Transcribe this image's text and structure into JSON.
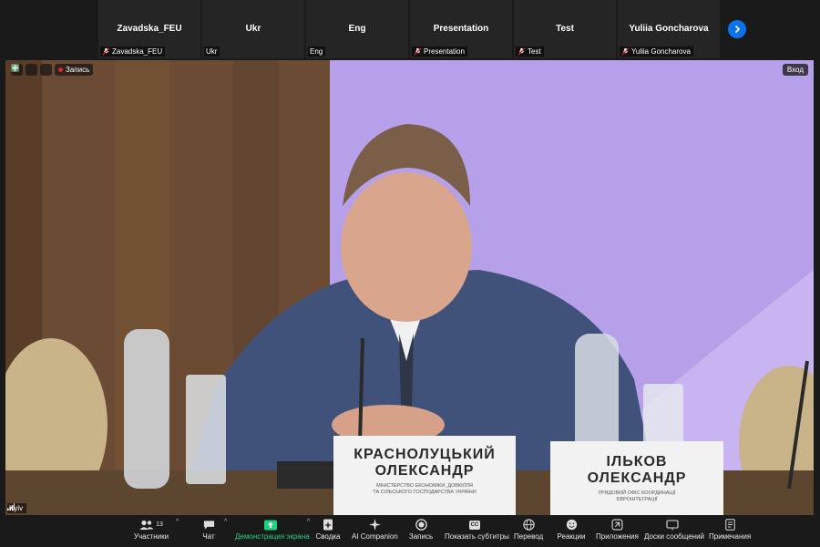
{
  "participants": [
    {
      "tile_name": "Zavadska_FEU",
      "label": "Zavadska_FEU",
      "muted": true
    },
    {
      "tile_name": "Ukr",
      "label": "Ukr",
      "muted": false
    },
    {
      "tile_name": "Eng",
      "label": "Eng",
      "muted": false
    },
    {
      "tile_name": "Presentation",
      "label": "Presentation",
      "muted": true
    },
    {
      "tile_name": "Test",
      "label": "Test",
      "muted": true
    },
    {
      "tile_name": "Yuliia Goncharova",
      "label": "Yuliia Goncharova",
      "muted": true
    }
  ],
  "main": {
    "recording_label": "Запись",
    "exit_label": "Вход",
    "speaker_label": "Kyiv",
    "nameplates": [
      {
        "line1": "КРАСНОЛУЦЬКИЙ",
        "line2": "ОЛЕКСАНДР",
        "sub1": "МІНІСТЕРСТВО ЕКОНОМІКИ, ДОВКІЛЛЯ",
        "sub2": "ТА СІЛЬСЬКОГО ГОСПОДАРСТВА УКРАЇНИ"
      },
      {
        "line1": "ІЛЬКОВ",
        "line2": "ОЛЕКСАНДР",
        "sub1": "УРЯДОВИЙ ОФІС КООРДИНАЦІЇ",
        "sub2": "ЄВРОІНТЕГРАЦІЇ"
      }
    ]
  },
  "toolbar": {
    "participants_count": "13",
    "items": [
      {
        "label": "Участники",
        "icon": "participants-icon"
      },
      {
        "label": "Чат",
        "icon": "chat-icon"
      },
      {
        "label": "Демонстрация экрана",
        "icon": "share-screen-icon"
      },
      {
        "label": "Сводка",
        "icon": "summary-icon"
      },
      {
        "label": "AI Companion",
        "icon": "ai-companion-icon"
      },
      {
        "label": "Запись",
        "icon": "record-icon"
      },
      {
        "label": "Показать субтитры",
        "icon": "captions-icon"
      },
      {
        "label": "Перевод",
        "icon": "translate-icon"
      },
      {
        "label": "Реакции",
        "icon": "reactions-icon"
      },
      {
        "label": "Приложения",
        "icon": "apps-icon"
      },
      {
        "label": "Доски сообщений",
        "icon": "whiteboard-icon"
      },
      {
        "label": "Примечания",
        "icon": "notes-icon"
      }
    ],
    "captions_badge": "CC"
  },
  "colors": {
    "accent": "#0e72ed",
    "share_green": "#1fd27f",
    "record_red": "#e02828",
    "background": "#1a1a1a"
  }
}
